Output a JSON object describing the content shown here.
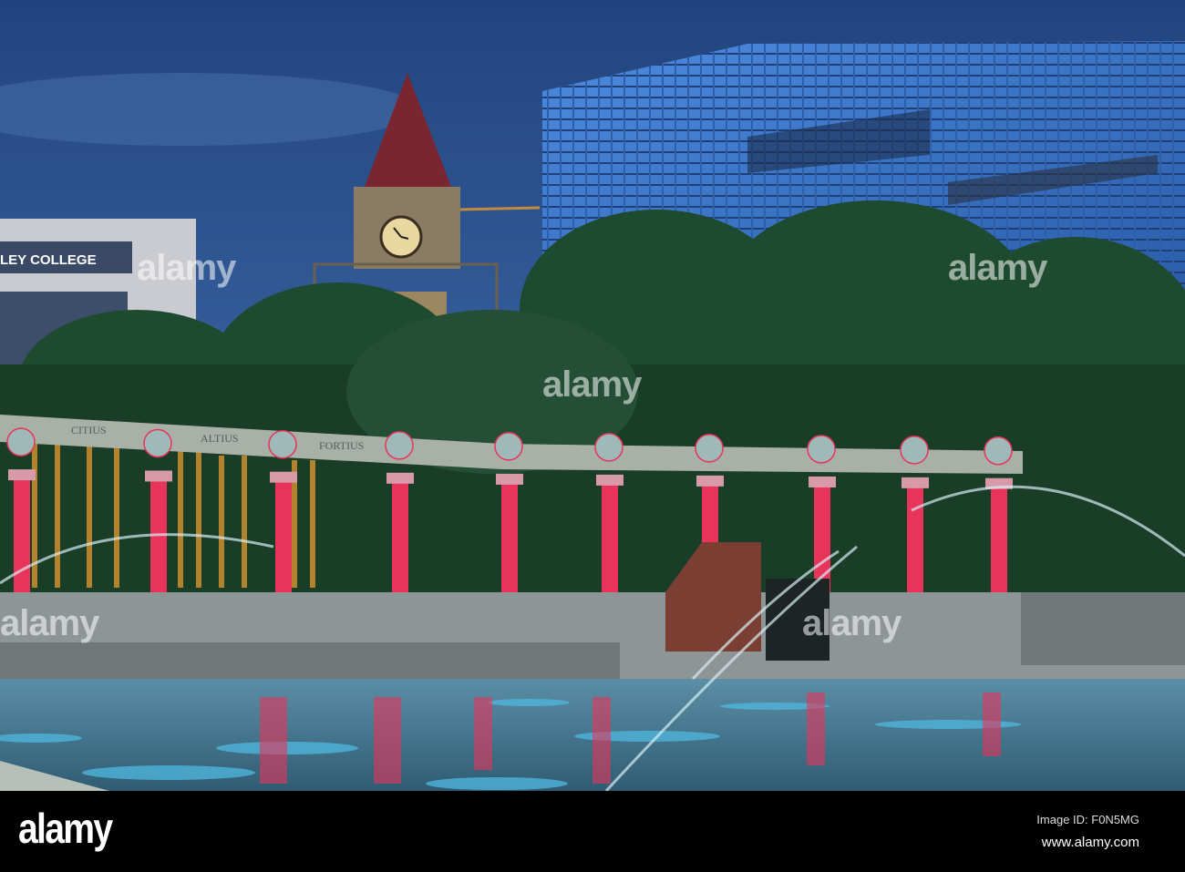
{
  "photo": {
    "college_sign": "LEY COLLEGE",
    "arch_inscriptions": [
      "CITIUS",
      "ALTIUS",
      "FORTIUS"
    ],
    "colors": {
      "sky": "#2c4f88",
      "building_glass": "#3d78c8",
      "pillar_red": "#e8335a",
      "foliage": "#1f4a2e",
      "water": "#3a6f86"
    }
  },
  "watermark": {
    "text": "alamy"
  },
  "footer": {
    "logo": "alamy",
    "image_id": "Image ID: F0N5MG",
    "url": "www.alamy.com"
  }
}
